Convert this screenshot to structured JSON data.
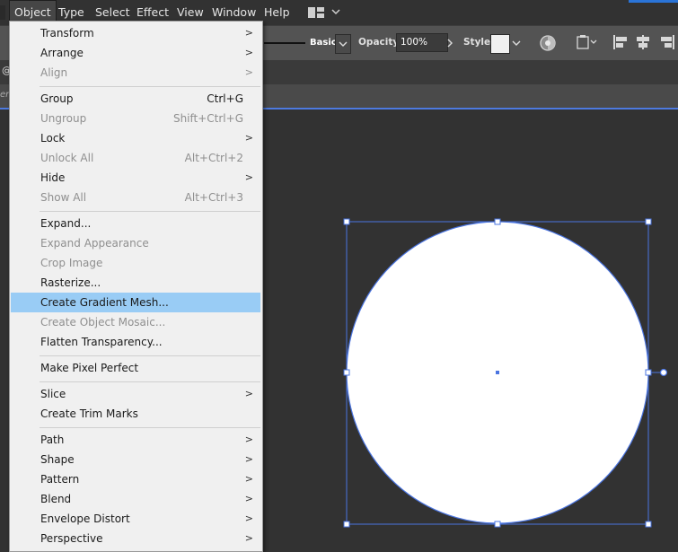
{
  "menubar": {
    "items": [
      {
        "label": "Object",
        "active": true
      },
      {
        "label": "Type"
      },
      {
        "label": "Select"
      },
      {
        "label": "Effect"
      },
      {
        "label": "View"
      },
      {
        "label": "Window"
      },
      {
        "label": "Help"
      }
    ],
    "workspace_icon": "workspace-layout-icon",
    "workspace_chevron": "chevron-down-icon"
  },
  "control_bar": {
    "brush_label": "Basic",
    "opacity_label": "Opacity:",
    "opacity_value": "100%",
    "style_label": "Style:",
    "style_swatch_color": "#f0f0f0"
  },
  "tab": {
    "label": "@"
  },
  "ruler": {
    "label": "er"
  },
  "object_menu": {
    "items": [
      {
        "label": "Transform",
        "submenu": true
      },
      {
        "label": "Arrange",
        "submenu": true
      },
      {
        "label": "Align",
        "submenu": true,
        "disabled": true
      },
      {
        "label": "Group",
        "shortcut": "Ctrl+G"
      },
      {
        "label": "Ungroup",
        "shortcut": "Shift+Ctrl+G",
        "disabled": true
      },
      {
        "label": "Lock",
        "submenu": true
      },
      {
        "label": "Unlock All",
        "shortcut": "Alt+Ctrl+2",
        "disabled": true
      },
      {
        "label": "Hide",
        "submenu": true
      },
      {
        "label": "Show All",
        "shortcut": "Alt+Ctrl+3",
        "disabled": true
      },
      {
        "label": "Expand..."
      },
      {
        "label": "Expand Appearance",
        "disabled": true
      },
      {
        "label": "Crop Image",
        "disabled": true
      },
      {
        "label": "Rasterize..."
      },
      {
        "label": "Create Gradient Mesh...",
        "highlighted": true
      },
      {
        "label": "Create Object Mosaic...",
        "disabled": true
      },
      {
        "label": "Flatten Transparency..."
      },
      {
        "label": "Make Pixel Perfect"
      },
      {
        "label": "Slice",
        "submenu": true
      },
      {
        "label": "Create Trim Marks"
      },
      {
        "label": "Path",
        "submenu": true
      },
      {
        "label": "Shape",
        "submenu": true
      },
      {
        "label": "Pattern",
        "submenu": true
      },
      {
        "label": "Blend",
        "submenu": true
      },
      {
        "label": "Envelope Distort",
        "submenu": true
      },
      {
        "label": "Perspective",
        "submenu": true
      }
    ],
    "submenu_arrow": ">"
  },
  "canvas": {
    "shape": "circle",
    "fill_color": "#ffffff",
    "selection_color": "#4a74e0"
  }
}
